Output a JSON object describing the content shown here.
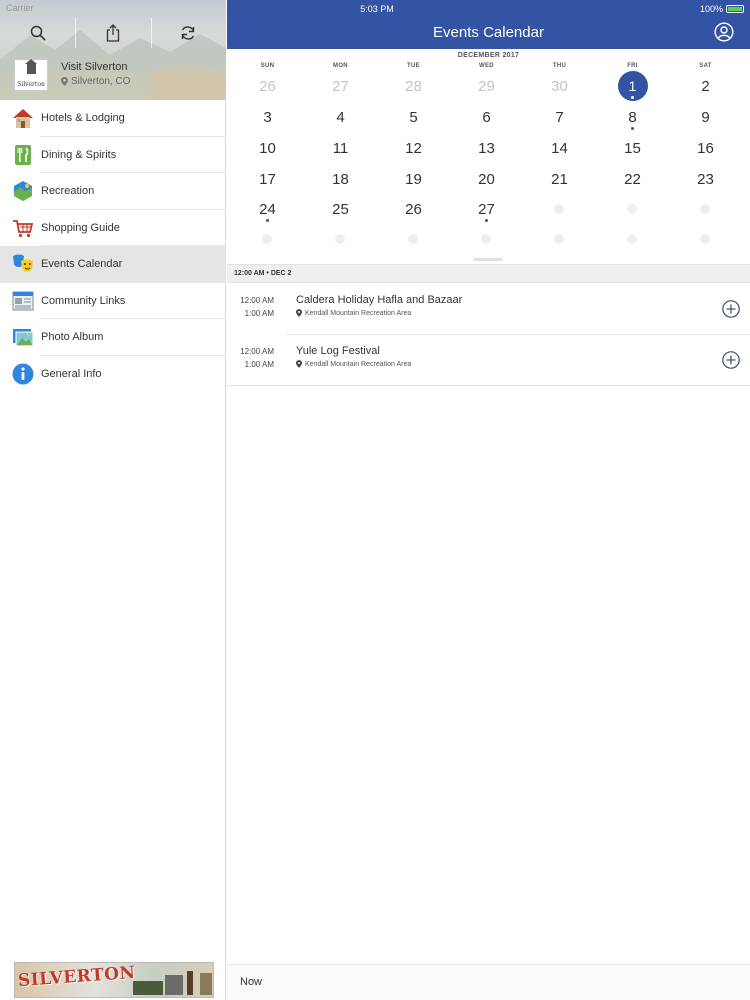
{
  "status": {
    "carrier": "Carrier",
    "time": "5:03 PM",
    "battery": "100%"
  },
  "sidebar": {
    "app_name": "Visit Silverton",
    "app_location": "Silverton, CO",
    "logo_text": "Silverton",
    "items": [
      {
        "label": "Hotels & Lodging",
        "icon": "house-icon"
      },
      {
        "label": "Dining & Spirits",
        "icon": "fork-knife-icon"
      },
      {
        "label": "Recreation",
        "icon": "recreation-icon"
      },
      {
        "label": "Shopping Guide",
        "icon": "shopping-cart-icon"
      },
      {
        "label": "Events Calendar",
        "icon": "theater-masks-icon",
        "active": true
      },
      {
        "label": "Community Links",
        "icon": "newspaper-icon"
      },
      {
        "label": "Photo Album",
        "icon": "photo-icon"
      },
      {
        "label": "General Info",
        "icon": "info-icon"
      }
    ],
    "banner_text": "SILVERTON"
  },
  "header": {
    "title": "Events Calendar"
  },
  "calendar": {
    "month": "DECEMBER 2017",
    "weekdays": [
      "SUN",
      "MON",
      "TUE",
      "WED",
      "THU",
      "FRI",
      "SAT"
    ],
    "weeks": [
      [
        "26",
        "27",
        "28",
        "29",
        "30",
        "1",
        "2"
      ],
      [
        "3",
        "4",
        "5",
        "6",
        "7",
        "8",
        "9"
      ],
      [
        "10",
        "11",
        "12",
        "13",
        "14",
        "15",
        "16"
      ],
      [
        "17",
        "18",
        "19",
        "20",
        "21",
        "22",
        "23"
      ],
      [
        "24",
        "25",
        "26",
        "27",
        "",
        "",
        ""
      ]
    ],
    "selected_day": "1"
  },
  "events_section": {
    "header": "12:00 AM • DEC 2",
    "events": [
      {
        "start": "12:00 AM",
        "end": "1:00 AM",
        "title": "Caldera Holiday Hafla and Bazaar",
        "location": "Kendall Mountain Recreation Area"
      },
      {
        "start": "12:00 AM",
        "end": "1:00 AM",
        "title": "Yule Log Festival",
        "location": "Kendall Mountain Recreation Area"
      }
    ]
  },
  "footer": {
    "now_label": "Now"
  },
  "colors": {
    "accent": "#3353a4",
    "active_row": "#e5e5e5",
    "battery": "#56d64a"
  }
}
